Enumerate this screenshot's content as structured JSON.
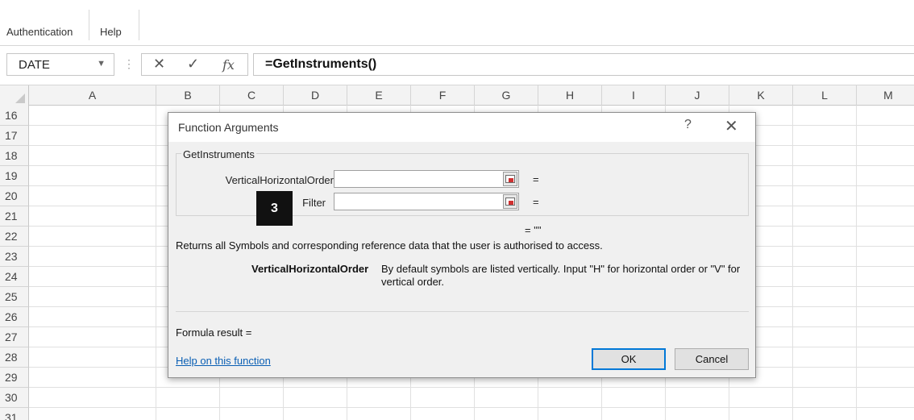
{
  "ribbon": {
    "tabs": [
      {
        "label": "Authentication"
      },
      {
        "label": "Help"
      }
    ]
  },
  "formula_bar": {
    "name_box": "DATE",
    "cancel_icon": "✕",
    "enter_icon": "✓",
    "function_icon": "fx",
    "formula": "=GetInstruments()"
  },
  "grid": {
    "columns": [
      "A",
      "B",
      "C",
      "D",
      "E",
      "F",
      "G",
      "H",
      "I",
      "J",
      "K",
      "L",
      "M"
    ],
    "rows": [
      "16",
      "17",
      "18",
      "19",
      "20",
      "21",
      "22",
      "23",
      "24",
      "25",
      "26",
      "27",
      "28",
      "29",
      "30",
      "31"
    ]
  },
  "dialog": {
    "title": "Function Arguments",
    "help_glyph": "?",
    "close_glyph": "✕",
    "function_name": "GetInstruments",
    "arguments": [
      {
        "label": "VerticalHorizontalOrder",
        "value": "",
        "equals": "="
      },
      {
        "label": "Filter",
        "value": "",
        "equals": "="
      }
    ],
    "result_preview": "= \"\"",
    "description": "Returns all Symbols and corresponding reference data that the user is authorised to access.",
    "param_name": "VerticalHorizontalOrder",
    "param_help": "By default symbols are listed vertically. Input \"H\" for horizontal order or \"V\" for vertical order.",
    "formula_result_label": "Formula result =",
    "help_link": "Help on this function",
    "ok_label": "OK",
    "cancel_label": "Cancel"
  },
  "step_badge": "3"
}
